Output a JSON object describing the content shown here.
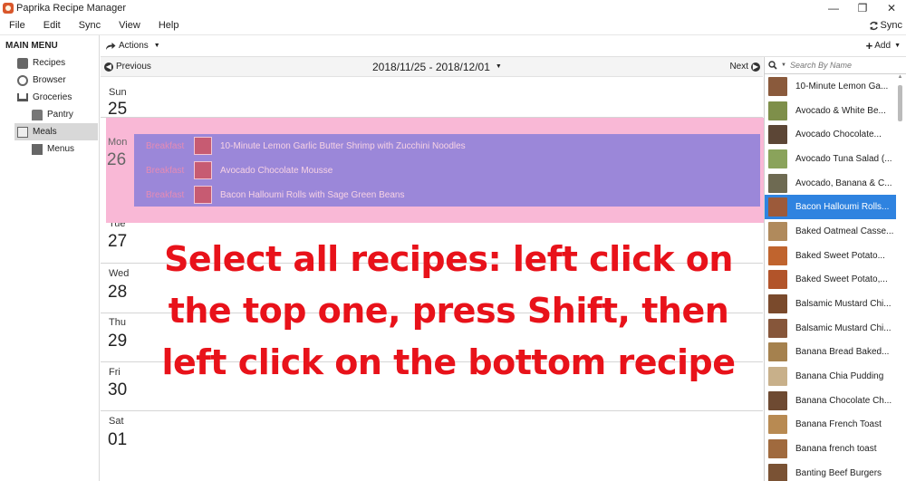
{
  "window": {
    "title": "Paprika Recipe Manager",
    "controls": [
      "—",
      "❐",
      "✕"
    ]
  },
  "menubar": {
    "items": [
      "File",
      "Edit",
      "Sync",
      "View",
      "Help"
    ],
    "sync_label": "Sync"
  },
  "sidebar": {
    "title": "MAIN MENU",
    "items": [
      {
        "label": "Recipes",
        "icon": "recipes-icon"
      },
      {
        "label": "Browser",
        "icon": "globe-icon"
      },
      {
        "label": "Groceries",
        "icon": "cart-icon"
      },
      {
        "label": "Pantry",
        "icon": "pantry-icon"
      },
      {
        "label": "Meals",
        "icon": "calendar-icon"
      },
      {
        "label": "Menus",
        "icon": "menus-icon"
      }
    ]
  },
  "toolbar": {
    "actions_label": "Actions",
    "add_label": "Add"
  },
  "calendar": {
    "prev_label": "Previous",
    "next_label": "Next",
    "date_range": "2018/11/25 - 2018/12/01",
    "days": [
      {
        "name": "Sun",
        "num": "25"
      },
      {
        "name": "Mon",
        "num": "26"
      },
      {
        "name": "Tue",
        "num": "27"
      },
      {
        "name": "Wed",
        "num": "28"
      },
      {
        "name": "Thu",
        "num": "29"
      },
      {
        "name": "Fri",
        "num": "30"
      },
      {
        "name": "Sat",
        "num": "01"
      }
    ],
    "meals": [
      {
        "type": "Breakfast",
        "name": "10-Minute Lemon Garlic Butter Shrimp with Zucchini Noodles"
      },
      {
        "type": "Breakfast",
        "name": "Avocado Chocolate Mousse"
      },
      {
        "type": "Breakfast",
        "name": "Bacon Halloumi Rolls with Sage Green Beans"
      }
    ]
  },
  "overlay_text": "Select all recipes: left click on the top one, press Shift, then left click on the bottom recipe",
  "recipes_panel": {
    "search_placeholder": "Search By Name",
    "items": [
      {
        "label": "10-Minute Lemon Ga...",
        "color": "#8a5a3c"
      },
      {
        "label": "Avocado & White Be...",
        "color": "#7e8f4a"
      },
      {
        "label": "Avocado Chocolate...",
        "color": "#5c4636"
      },
      {
        "label": "Avocado Tuna Salad (...",
        "color": "#8aa35b"
      },
      {
        "label": "Avocado, Banana & C...",
        "color": "#6e6a52"
      },
      {
        "label": "Bacon Halloumi Rolls...",
        "color": "#9c5a3a",
        "selected": true
      },
      {
        "label": "Baked Oatmeal Casse...",
        "color": "#b08a5c"
      },
      {
        "label": "Baked Sweet Potato...",
        "color": "#c0642e"
      },
      {
        "label": "Baked Sweet Potato,...",
        "color": "#b2542a"
      },
      {
        "label": "Balsamic Mustard Chi...",
        "color": "#7a4a2c"
      },
      {
        "label": "Balsamic Mustard Chi...",
        "color": "#86563a"
      },
      {
        "label": "Banana Bread Baked...",
        "color": "#a5814e"
      },
      {
        "label": "Banana Chia Pudding",
        "color": "#c8b08a"
      },
      {
        "label": "Banana Chocolate Ch...",
        "color": "#6e4a32"
      },
      {
        "label": "Banana French Toast",
        "color": "#b88a52"
      },
      {
        "label": "Banana french toast",
        "color": "#a06a3e"
      },
      {
        "label": "Banting Beef Burgers",
        "color": "#7a5234"
      }
    ]
  }
}
